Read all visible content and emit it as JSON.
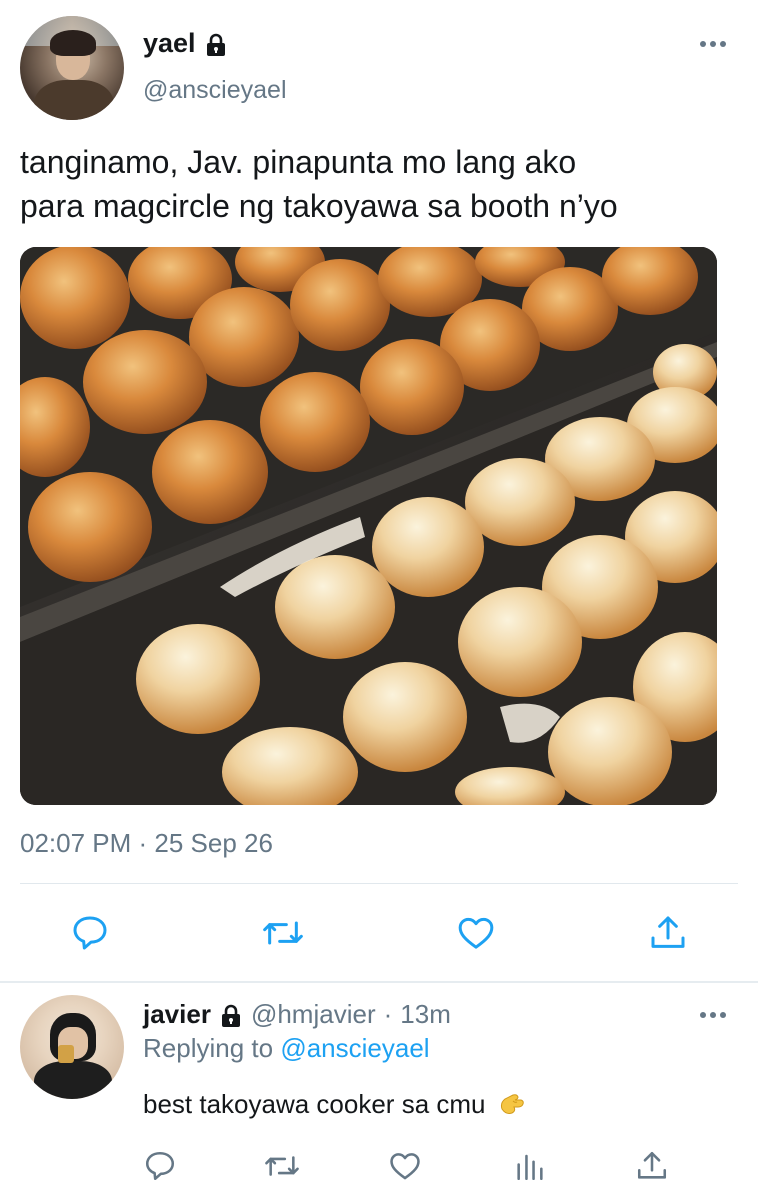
{
  "tweet": {
    "author": {
      "display_name": "yael",
      "handle": "@anscieyael",
      "protected": true
    },
    "text": "tanginamo, Jav. pinapunta mo lang ako\npara magcircle ng takoyawa sa booth n’yo",
    "media_alt": "takoyaki balls cooking on a griddle",
    "timestamp": "02:07 PM · 25 Sep 26",
    "actions": [
      {
        "name": "reply",
        "icon": "speech-bubble-icon"
      },
      {
        "name": "retweet",
        "icon": "retweet-icon"
      },
      {
        "name": "like",
        "icon": "heart-icon"
      },
      {
        "name": "share",
        "icon": "share-icon"
      }
    ]
  },
  "reply": {
    "author": {
      "display_name": "javier",
      "handle": "@hmjavier",
      "protected": true
    },
    "separator": "·",
    "time": "13m",
    "replying_prefix": "Replying to",
    "replying_mention": "@anscieyael",
    "text": "best takoyawa cooker sa cmu",
    "emoji": "pinching-hand-emoji",
    "actions": [
      {
        "name": "reply",
        "icon": "speech-bubble-icon"
      },
      {
        "name": "retweet",
        "icon": "retweet-icon"
      },
      {
        "name": "like",
        "icon": "heart-icon"
      },
      {
        "name": "analytics",
        "icon": "bar-chart-icon"
      },
      {
        "name": "share",
        "icon": "share-icon"
      }
    ]
  },
  "colors": {
    "text_primary": "#14171a",
    "text_secondary": "#657786",
    "link": "#1da1f2",
    "icon": "#1da1f2",
    "divider": "#e1e8ed"
  }
}
